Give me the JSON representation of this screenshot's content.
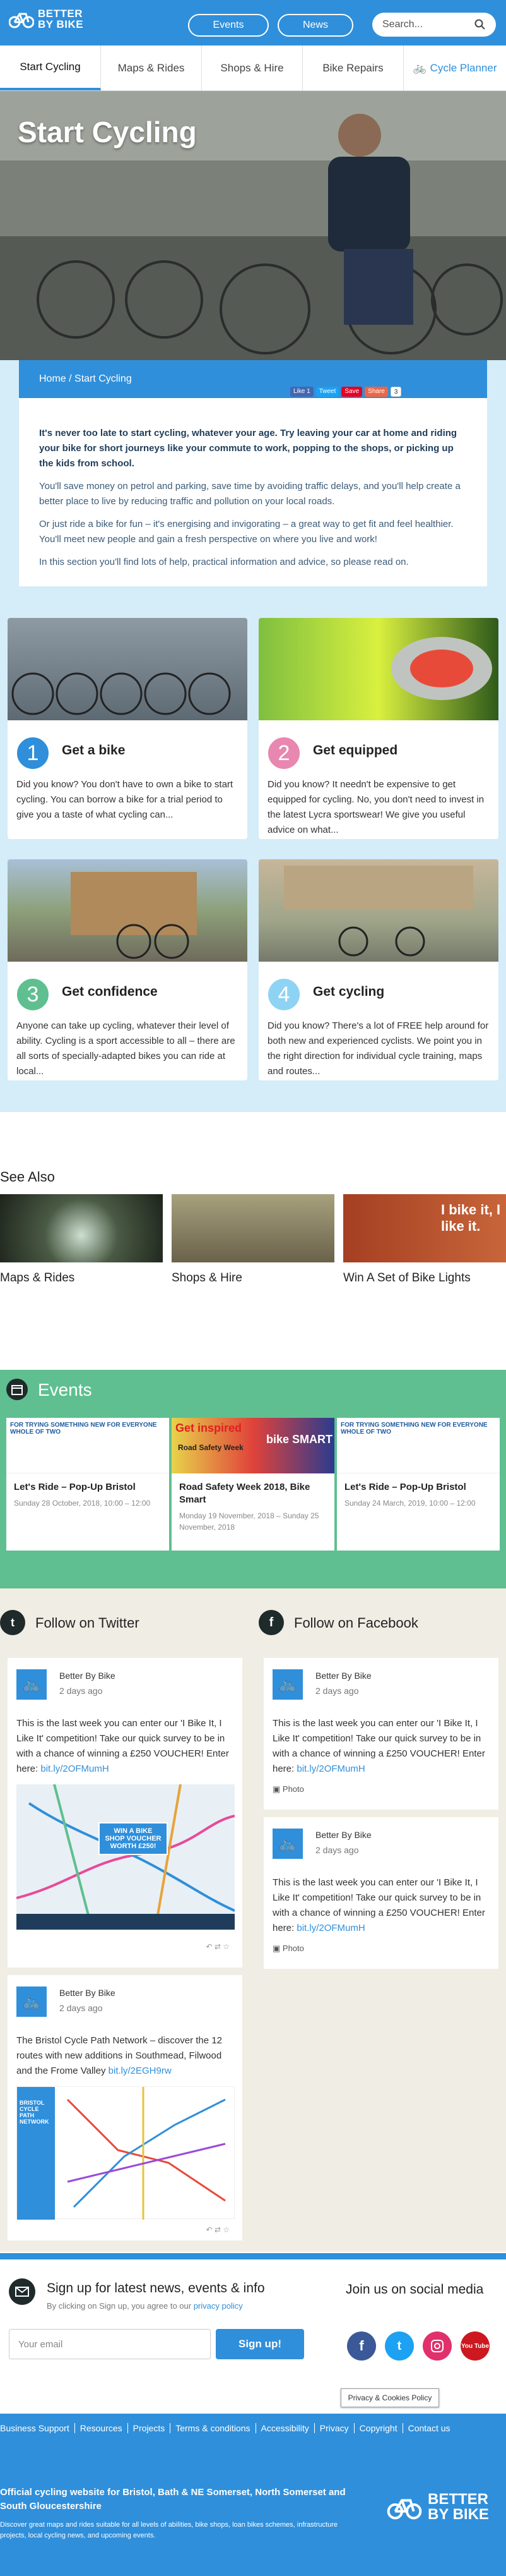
{
  "header": {
    "logo_line1": "BETTER",
    "logo_line2": "BY BIKE",
    "events": "Events",
    "news": "News",
    "search_placeholder": "Search..."
  },
  "tabs": [
    "Start Cycling",
    "Maps & Rides",
    "Shops & Hire",
    "Bike Repairs",
    "Cycle Planner"
  ],
  "hero": {
    "title": "Start Cycling"
  },
  "breadcrumb": "Home / Start Cycling",
  "share": {
    "like": "Like 1",
    "tweet": "Tweet",
    "save": "Save",
    "share": "Share",
    "count": "3"
  },
  "intro": {
    "p1": "It's never too late to start cycling, whatever your age. Try leaving your car at home and riding your bike for short journeys like your commute to work, popping to the shops, or picking up the kids from school.",
    "p2": "You'll save money on petrol and parking, save time by avoiding traffic delays, and you'll help create a better place to live by reducing traffic and pollution on your local roads.",
    "p3": "Or just ride a bike for fun – it's energising and invigorating – a great way to get fit and feel healthier. You'll meet new people and gain a fresh perspective on where you live and work!",
    "p4": "In this section you'll find lots of help, practical information and advice, so please read on."
  },
  "cards": [
    {
      "num": "1",
      "title": "Get a bike",
      "text": "Did you know? You don't have to own a bike to start cycling. You can borrow a bike for a trial period to give you a taste of what cycling can...",
      "color": "#2f8fdb"
    },
    {
      "num": "2",
      "title": "Get equipped",
      "text": "Did you know? It needn't be expensive to get equipped for cycling. No, you don't need to invest in the latest Lycra sportswear! We give you useful advice on what...",
      "color": "#e887b0"
    },
    {
      "num": "3",
      "title": "Get confidence",
      "text": "Anyone can take up cycling, whatever their level of ability. Cycling is a sport accessible to all – there are all sorts of specially-adapted bikes you can ride at local...",
      "color": "#5fbf90"
    },
    {
      "num": "4",
      "title": "Get cycling",
      "text": "Did you know? There's a lot of FREE help around for both new and experienced cyclists. We point you in the right direction for individual cycle training, maps and routes...",
      "color": "#8fd3f4"
    }
  ],
  "see_also": {
    "heading": "See Also",
    "items": [
      "Maps & Rides",
      "Shops & Hire",
      "Win A Set of Bike Lights"
    ],
    "img_text": "I bike it, I like it."
  },
  "events": {
    "heading": "Events",
    "items": [
      {
        "title": "Let's Ride – Pop-Up Bristol",
        "date": "Sunday 28 October, 2018, 10:00 – 12:00"
      },
      {
        "title": "Road Safety Week 2018, Bike Smart",
        "date": "Monday 19 November, 2018 – Sunday 25 November, 2018"
      },
      {
        "title": "Let's Ride – Pop-Up Bristol",
        "date": "Sunday 24 March, 2019, 10:00 – 12:00"
      }
    ],
    "img1": "FOR TRYING SOMETHING NEW FOR EVERYONE WHOLE OF TWO",
    "img2a": "Get inspired",
    "img2b": "bike SMART",
    "img2c": "Road Safety Week"
  },
  "twitter": {
    "heading": "Follow on Twitter",
    "posts": [
      {
        "name": "Better By Bike",
        "time": "2 days ago",
        "text": "This is the last week you can enter our 'I Bike It, I Like It' competition! Take our quick survey to be in with a chance of winning a £250 VOUCHER! Enter here: ",
        "link": "bit.ly/2OFMumH",
        "img": "WIN A BIKE SHOP VOUCHER WORTH £250!"
      },
      {
        "name": "Better By Bike",
        "time": "2 days ago",
        "text": "The Bristol Cycle Path Network – discover the 12 routes with new additions in Southmead, Filwood and the Frome Valley ",
        "link": "bit.ly/2EGH9rw",
        "img": "BRISTOL CYCLE PATH NETWORK"
      }
    ]
  },
  "facebook": {
    "heading": "Follow on Facebook",
    "posts": [
      {
        "name": "Better By Bike",
        "time": "2 days ago",
        "text": "This is the last week you can enter our 'I Bike It, I Like It' competition! Take our quick survey to be in with a chance of winning a £250 VOUCHER! Enter here: ",
        "link": "bit.ly/2OFMumH",
        "photo": "Photo"
      },
      {
        "name": "Better By Bike",
        "time": "2 days ago",
        "text": "This is the last week you can enter our 'I Bike It, I Like It' competition! Take our quick survey to be in with a chance of winning a £250 VOUCHER! Enter here: ",
        "link": "bit.ly/2OFMumH",
        "photo": "Photo"
      }
    ]
  },
  "signup": {
    "heading": "Sign up for latest news, events & info",
    "sub": "By clicking on Sign up, you agree to our ",
    "policy": "privacy policy",
    "email_placeholder": "Your email",
    "button": "Sign up!"
  },
  "social": {
    "heading": "Join us on social media",
    "yt": "You Tube"
  },
  "privacy_btn": "Privacy & Cookies Policy",
  "footer_links": [
    "Business Support",
    "Resources",
    "Projects",
    "Terms & conditions",
    "Accessibility",
    "Privacy",
    "Copyright",
    "Contact us"
  ],
  "footer": {
    "title": "Official cycling website for Bristol, Bath & NE Somerset, North Somerset and South Gloucestershire",
    "desc": "Discover great maps and rides suitable for all levels of abilities, bike shops, loan bikes schemes, infrastructure projects, local cycling news, and upcoming events.",
    "logo1": "BETTER",
    "logo2": "BY BIKE"
  }
}
